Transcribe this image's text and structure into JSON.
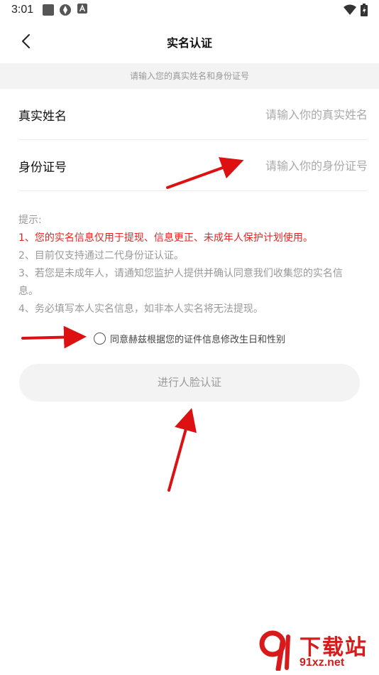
{
  "status_bar": {
    "time": "3:01",
    "icons": [
      "square-icon",
      "media-icon",
      "a-icon",
      "wifi-icon",
      "battery-icon"
    ]
  },
  "header": {
    "title": "实名认证",
    "back_icon": "chevron-left-icon"
  },
  "hint": "请输入您的真实姓名和身份证号",
  "form": {
    "name_label": "真实姓名",
    "name_placeholder": "请输入你的真实姓名",
    "id_label": "身份证号",
    "id_placeholder": "请输入你的身份证号"
  },
  "tips": {
    "title": "提示:",
    "items": [
      "1、您的实名信息仅用于提现、信息更正、未成年人保护计划使用。",
      "2、目前仅支持通过二代身份证认证。",
      "3、若您是未成年人，请通知您监护人提供并确认同意我们收集您的实名信息。",
      "4、务必填写本人实名信息，如非本人实名将无法提现。"
    ]
  },
  "agreement": {
    "checked": false,
    "text": "同意赫兹根据您的证件信息修改生日和性别"
  },
  "face_button": "进行人脸认证",
  "watermark": {
    "text": "下载站",
    "url": "91xz.net"
  },
  "colors": {
    "tip_red": "#ee2222",
    "arrow_red": "#dd1111",
    "hint_bg": "#f3f3f3",
    "watermark_red": "#d81a1a"
  }
}
